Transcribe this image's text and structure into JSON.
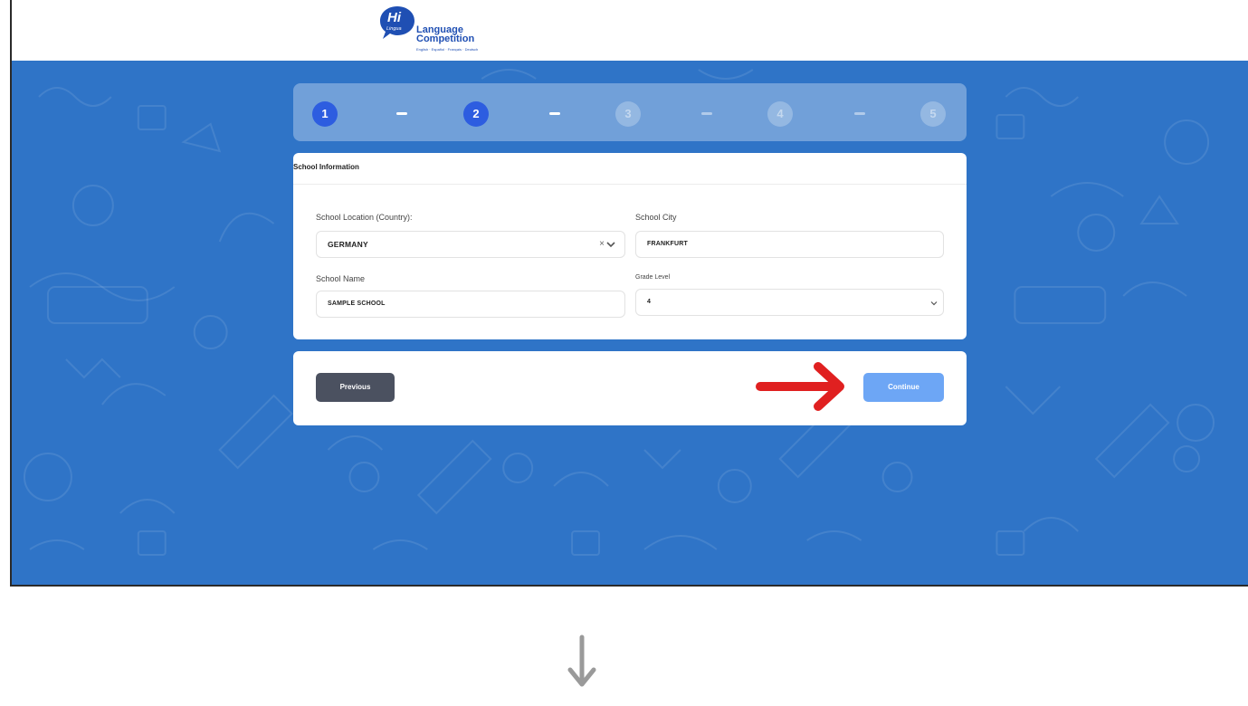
{
  "header": {
    "logo_hi": "Hi",
    "logo_lingua": "Lingua",
    "logo_line1": "Language",
    "logo_line2": "Competition",
    "logo_tagline": "English · Español · Français · Deutsch"
  },
  "stepper": {
    "steps": [
      {
        "label": "1",
        "state": "active"
      },
      {
        "label": "2",
        "state": "active"
      },
      {
        "label": "3",
        "state": "inactive"
      },
      {
        "label": "4",
        "state": "inactive"
      },
      {
        "label": "5",
        "state": "inactive"
      }
    ],
    "dashes": [
      "on",
      "on",
      "off",
      "off"
    ]
  },
  "school_info": {
    "title": "School Information",
    "country_label": "School Location (Country):",
    "country_value": "GERMANY",
    "clear_icon": "clear-icon",
    "city_label": "School City",
    "city_value": "FRANKFURT",
    "name_label": "School Name",
    "name_value": "SAMPLE SCHOOL",
    "grade_label": "Grade Level",
    "grade_value": "4"
  },
  "navigation": {
    "previous_label": "Previous",
    "continue_label": "Continue"
  },
  "colors": {
    "hero_bg": "#2f74c7",
    "active_step": "#2d5de0",
    "continue_btn": "#6da6f5",
    "previous_btn": "#4b5160",
    "annotation_arrow": "#e02020",
    "flow_arrow": "#9a9a9a"
  },
  "icons": {
    "annotation": "red-arrow-icon",
    "flow": "down-arrow-icon"
  }
}
